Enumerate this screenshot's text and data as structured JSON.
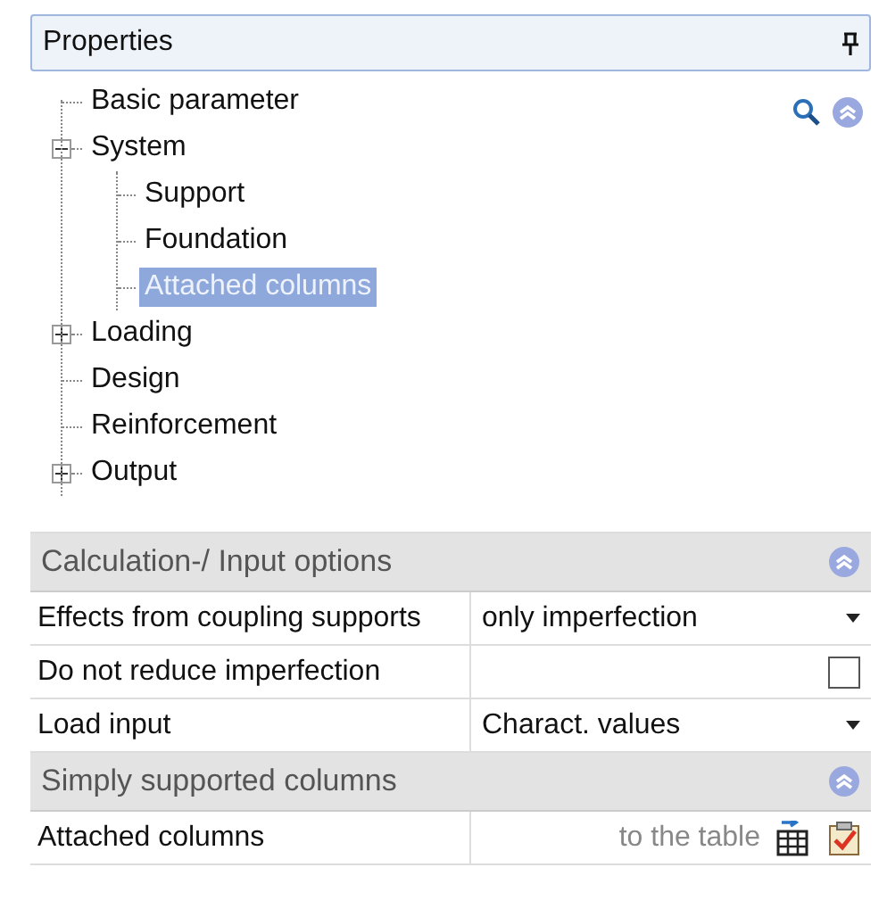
{
  "panel": {
    "title": "Properties"
  },
  "tree": [
    {
      "label": "Basic parameter",
      "selected": false
    },
    {
      "label": "System",
      "selected": false,
      "expanded": true,
      "children": [
        {
          "label": "Support",
          "selected": false
        },
        {
          "label": "Foundation",
          "selected": false
        },
        {
          "label": "Attached columns",
          "selected": true
        }
      ]
    },
    {
      "label": "Loading",
      "selected": false,
      "expanded": false
    },
    {
      "label": "Design",
      "selected": false
    },
    {
      "label": "Reinforcement",
      "selected": false
    },
    {
      "label": "Output",
      "selected": false,
      "expanded": false
    }
  ],
  "grid": [
    {
      "kind": "section",
      "label": "Calculation-/ Input options"
    },
    {
      "kind": "dropdown",
      "label": "Effects from coupling supports",
      "value": "only imperfection"
    },
    {
      "kind": "checkbox",
      "label": "Do not reduce imperfection",
      "checked": false
    },
    {
      "kind": "dropdown",
      "label": "Load input",
      "value": "Charact. values"
    },
    {
      "kind": "section",
      "label": "Simply supported columns"
    },
    {
      "kind": "link",
      "label": "Attached columns",
      "value": "to the table"
    }
  ]
}
